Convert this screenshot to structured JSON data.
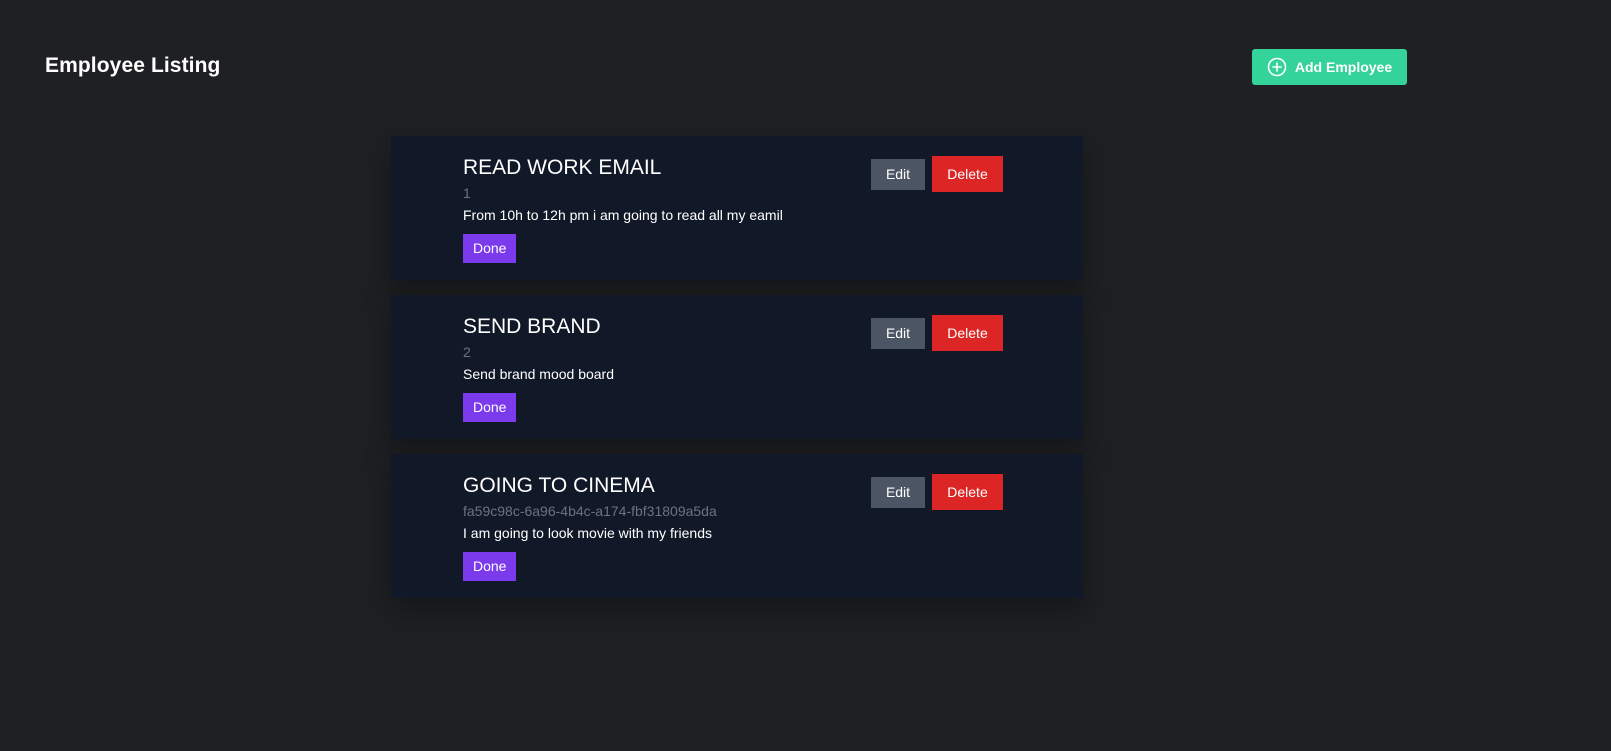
{
  "header": {
    "title": "Employee Listing",
    "add_button_label": "Add Employee",
    "add_button_icon": "plus-circle-icon"
  },
  "colors": {
    "background": "#1f2023",
    "card": "#111827",
    "add_button": "#34d399",
    "done_button": "#7c3aed",
    "edit_button": "#4b5563",
    "delete_button": "#dc2626",
    "id_text": "#6b7280"
  },
  "tasks": [
    {
      "title": "READ WORK EMAIL",
      "id": "1",
      "description": "From 10h to 12h pm i am going to read all my eamil",
      "done_label": "Done",
      "edit_label": "Edit",
      "delete_label": "Delete"
    },
    {
      "title": "SEND BRAND",
      "id": "2",
      "description": "Send brand mood board",
      "done_label": "Done",
      "edit_label": "Edit",
      "delete_label": "Delete"
    },
    {
      "title": "GOING TO CINEMA",
      "id": "fa59c98c-6a96-4b4c-a174-fbf31809a5da",
      "description": "I am going to look movie with my friends",
      "done_label": "Done",
      "edit_label": "Edit",
      "delete_label": "Delete"
    }
  ]
}
